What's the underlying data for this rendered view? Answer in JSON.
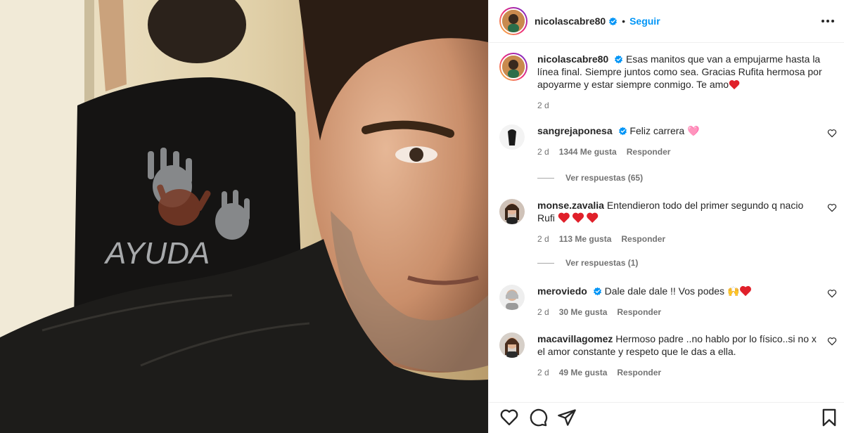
{
  "post": {
    "author": "nicolascabre80",
    "follow_label": "Seguir",
    "separator": "•",
    "caption": "Esas manitos que van a empujarme hasta la línea final. Siempre juntos como sea. Gracias Rufita hermosa por apoyarme y estar siempre conmigo. Te amo",
    "caption_emoji": "heart",
    "time": "2 d"
  },
  "comments": [
    {
      "user": "sangrejaponesa",
      "verified": true,
      "text": "Feliz carrera 🩷",
      "time": "2 d",
      "likes": "1344 Me gusta",
      "reply_label": "Responder",
      "view_replies": "Ver respuestas (65)"
    },
    {
      "user": "monse.zavalia",
      "verified": false,
      "text": "Entendieron todo del primer segundo q nacio Rufi",
      "text_emoji": "three-hearts",
      "time": "2 d",
      "likes": "113 Me gusta",
      "reply_label": "Responder",
      "view_replies": "Ver respuestas (1)"
    },
    {
      "user": "meroviedo",
      "verified": true,
      "text": "Dale dale dale !! Vos podes 🙌",
      "time": "2 d",
      "likes": "30 Me gusta",
      "reply_label": "Responder"
    },
    {
      "user": "macavillagomez",
      "verified": false,
      "text": "Hermoso padre ..no hablo por lo físico..si no x el amor constante y respeto que le das a ella.",
      "time": "2 d",
      "likes": "49 Me gusta",
      "reply_label": "Responder"
    }
  ],
  "icons": {
    "like": "heart-outline-icon",
    "comment": "comment-bubble-icon",
    "share": "paper-plane-icon",
    "save": "bookmark-icon",
    "verified": "verified-badge-icon",
    "more": "more-dots-icon"
  },
  "colors": {
    "accent": "#0095f6",
    "text": "#262626",
    "muted": "#737373",
    "heart": "#ed4956"
  }
}
